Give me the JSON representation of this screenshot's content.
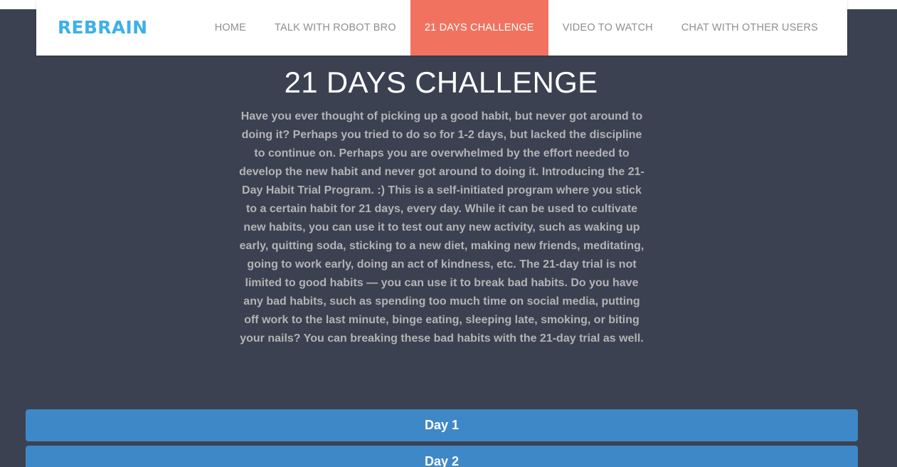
{
  "navbar": {
    "brand": "REBRAIN",
    "items": [
      {
        "label": "HOME",
        "active": false
      },
      {
        "label": "TALK WITH ROBOT BRO",
        "active": false
      },
      {
        "label": "21 DAYS CHALLENGE",
        "active": true
      },
      {
        "label": "VIDEO TO WATCH",
        "active": false
      },
      {
        "label": "CHAT WITH OTHER USERS",
        "active": false
      }
    ]
  },
  "main": {
    "title": "21 DAYS CHALLENGE",
    "intro": "Have you ever thought of picking up a good habit, but never got around to doing it? Perhaps you tried to do so for 1-2 days, but lacked the discipline to continue on. Perhaps you are overwhelmed by the effort needed to develop the new habit and never got around to doing it. Introducing the 21-Day Habit Trial Program. :) This is a self-initiated program where you stick to a certain habit for 21 days, every day. While it can be used to cultivate new habits, you can use it to test out any new activity, such as waking up early, quitting soda, sticking to a new diet, making new friends, meditating, going to work early, doing an act of kindness, etc. The 21-day trial is not limited to good habits — you can use it to break bad habits. Do you have any bad habits, such as spending too much time on social media, putting off work to the last minute, binge eating, sleeping late, smoking, or biting your nails? You can breaking these bad habits with the 21-day trial as well.",
    "days": [
      {
        "label": "Day 1"
      },
      {
        "label": "Day 2"
      }
    ]
  },
  "colors": {
    "background": "#3b4151",
    "brand": "#3db0e8",
    "active_nav": "#f1735f",
    "day_button": "#3f88c8"
  }
}
